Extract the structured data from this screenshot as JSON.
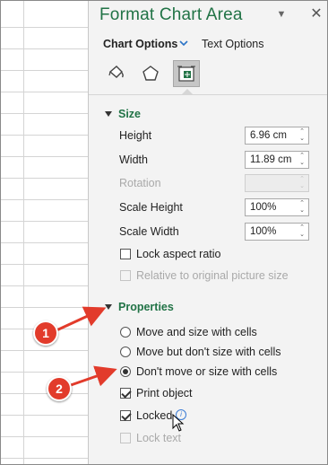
{
  "pane": {
    "title": "Format Chart Area",
    "close_symbol": "✕",
    "dropdown_symbol": "▼"
  },
  "tabs": {
    "chart_options": "Chart Options",
    "text_options": "Text Options"
  },
  "category_icons": [
    "fill-line-icon",
    "effects-pentagon-icon",
    "size-properties-icon"
  ],
  "size": {
    "heading": "Size",
    "height_label": "Height",
    "height_value": "6.96 cm",
    "width_label": "Width",
    "width_value": "11.89 cm",
    "rotation_label": "Rotation",
    "rotation_value": "",
    "scale_height_label": "Scale Height",
    "scale_height_value": "100%",
    "scale_width_label": "Scale Width",
    "scale_width_value": "100%",
    "lock_aspect_label": "Lock aspect ratio",
    "relative_label": "Relative to original picture size"
  },
  "properties": {
    "heading": "Properties",
    "move_and_size": "Move and size with cells",
    "move_no_size": "Move but don't size with cells",
    "dont_move": "Don't move or size with cells",
    "print_object": "Print object",
    "locked": "Locked",
    "lock_text": "Lock text"
  },
  "annotations": {
    "badge_1": "1",
    "badge_2": "2"
  },
  "colors": {
    "accent_green": "#217346",
    "annotation_red": "#e23b2b"
  }
}
